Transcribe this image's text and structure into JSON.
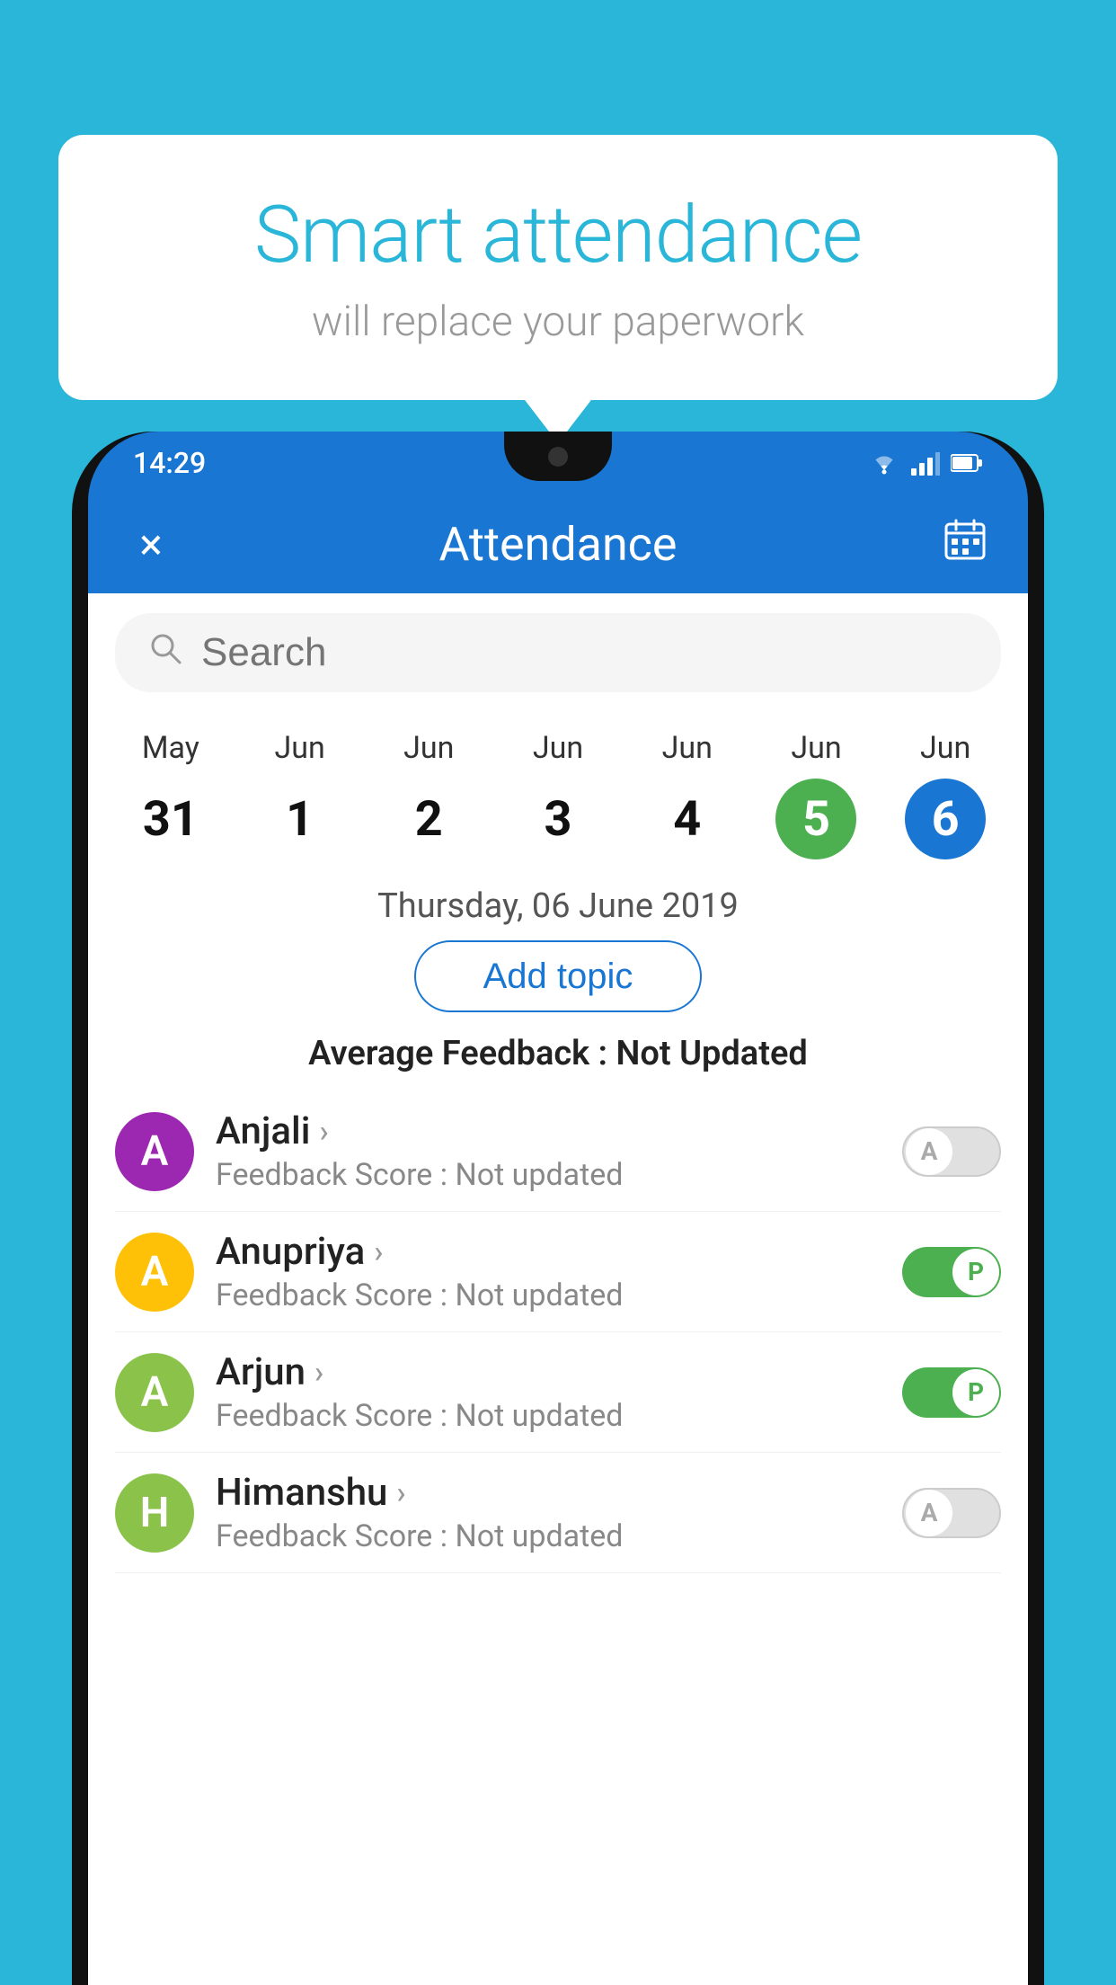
{
  "background_color": "#29b6d8",
  "speech_bubble": {
    "title": "Smart attendance",
    "subtitle": "will replace your paperwork"
  },
  "status_bar": {
    "time": "14:29",
    "icons": [
      "wifi",
      "signal",
      "battery"
    ]
  },
  "app_bar": {
    "title": "Attendance",
    "close_icon": "×",
    "calendar_icon": "📅"
  },
  "search": {
    "placeholder": "Search"
  },
  "calendar": {
    "days": [
      {
        "month": "May",
        "date": "31",
        "state": "normal"
      },
      {
        "month": "Jun",
        "date": "1",
        "state": "normal"
      },
      {
        "month": "Jun",
        "date": "2",
        "state": "normal"
      },
      {
        "month": "Jun",
        "date": "3",
        "state": "normal"
      },
      {
        "month": "Jun",
        "date": "4",
        "state": "normal"
      },
      {
        "month": "Jun",
        "date": "5",
        "state": "today"
      },
      {
        "month": "Jun",
        "date": "6",
        "state": "selected"
      }
    ]
  },
  "selected_date_label": "Thursday, 06 June 2019",
  "add_topic_label": "Add topic",
  "avg_feedback_label": "Average Feedback :",
  "avg_feedback_value": "Not Updated",
  "students": [
    {
      "name": "Anjali",
      "initial": "A",
      "avatar_color": "#9c27b0",
      "score_label": "Feedback Score : Not updated",
      "toggle": "off",
      "toggle_letter": "A"
    },
    {
      "name": "Anupriya",
      "initial": "A",
      "avatar_color": "#ffc107",
      "score_label": "Feedback Score : Not updated",
      "toggle": "on",
      "toggle_letter": "P"
    },
    {
      "name": "Arjun",
      "initial": "A",
      "avatar_color": "#8bc34a",
      "score_label": "Feedback Score : Not updated",
      "toggle": "on",
      "toggle_letter": "P"
    },
    {
      "name": "Himanshu",
      "initial": "H",
      "avatar_color": "#8bc34a",
      "score_label": "Feedback Score : Not updated",
      "toggle": "off",
      "toggle_letter": "A"
    }
  ]
}
